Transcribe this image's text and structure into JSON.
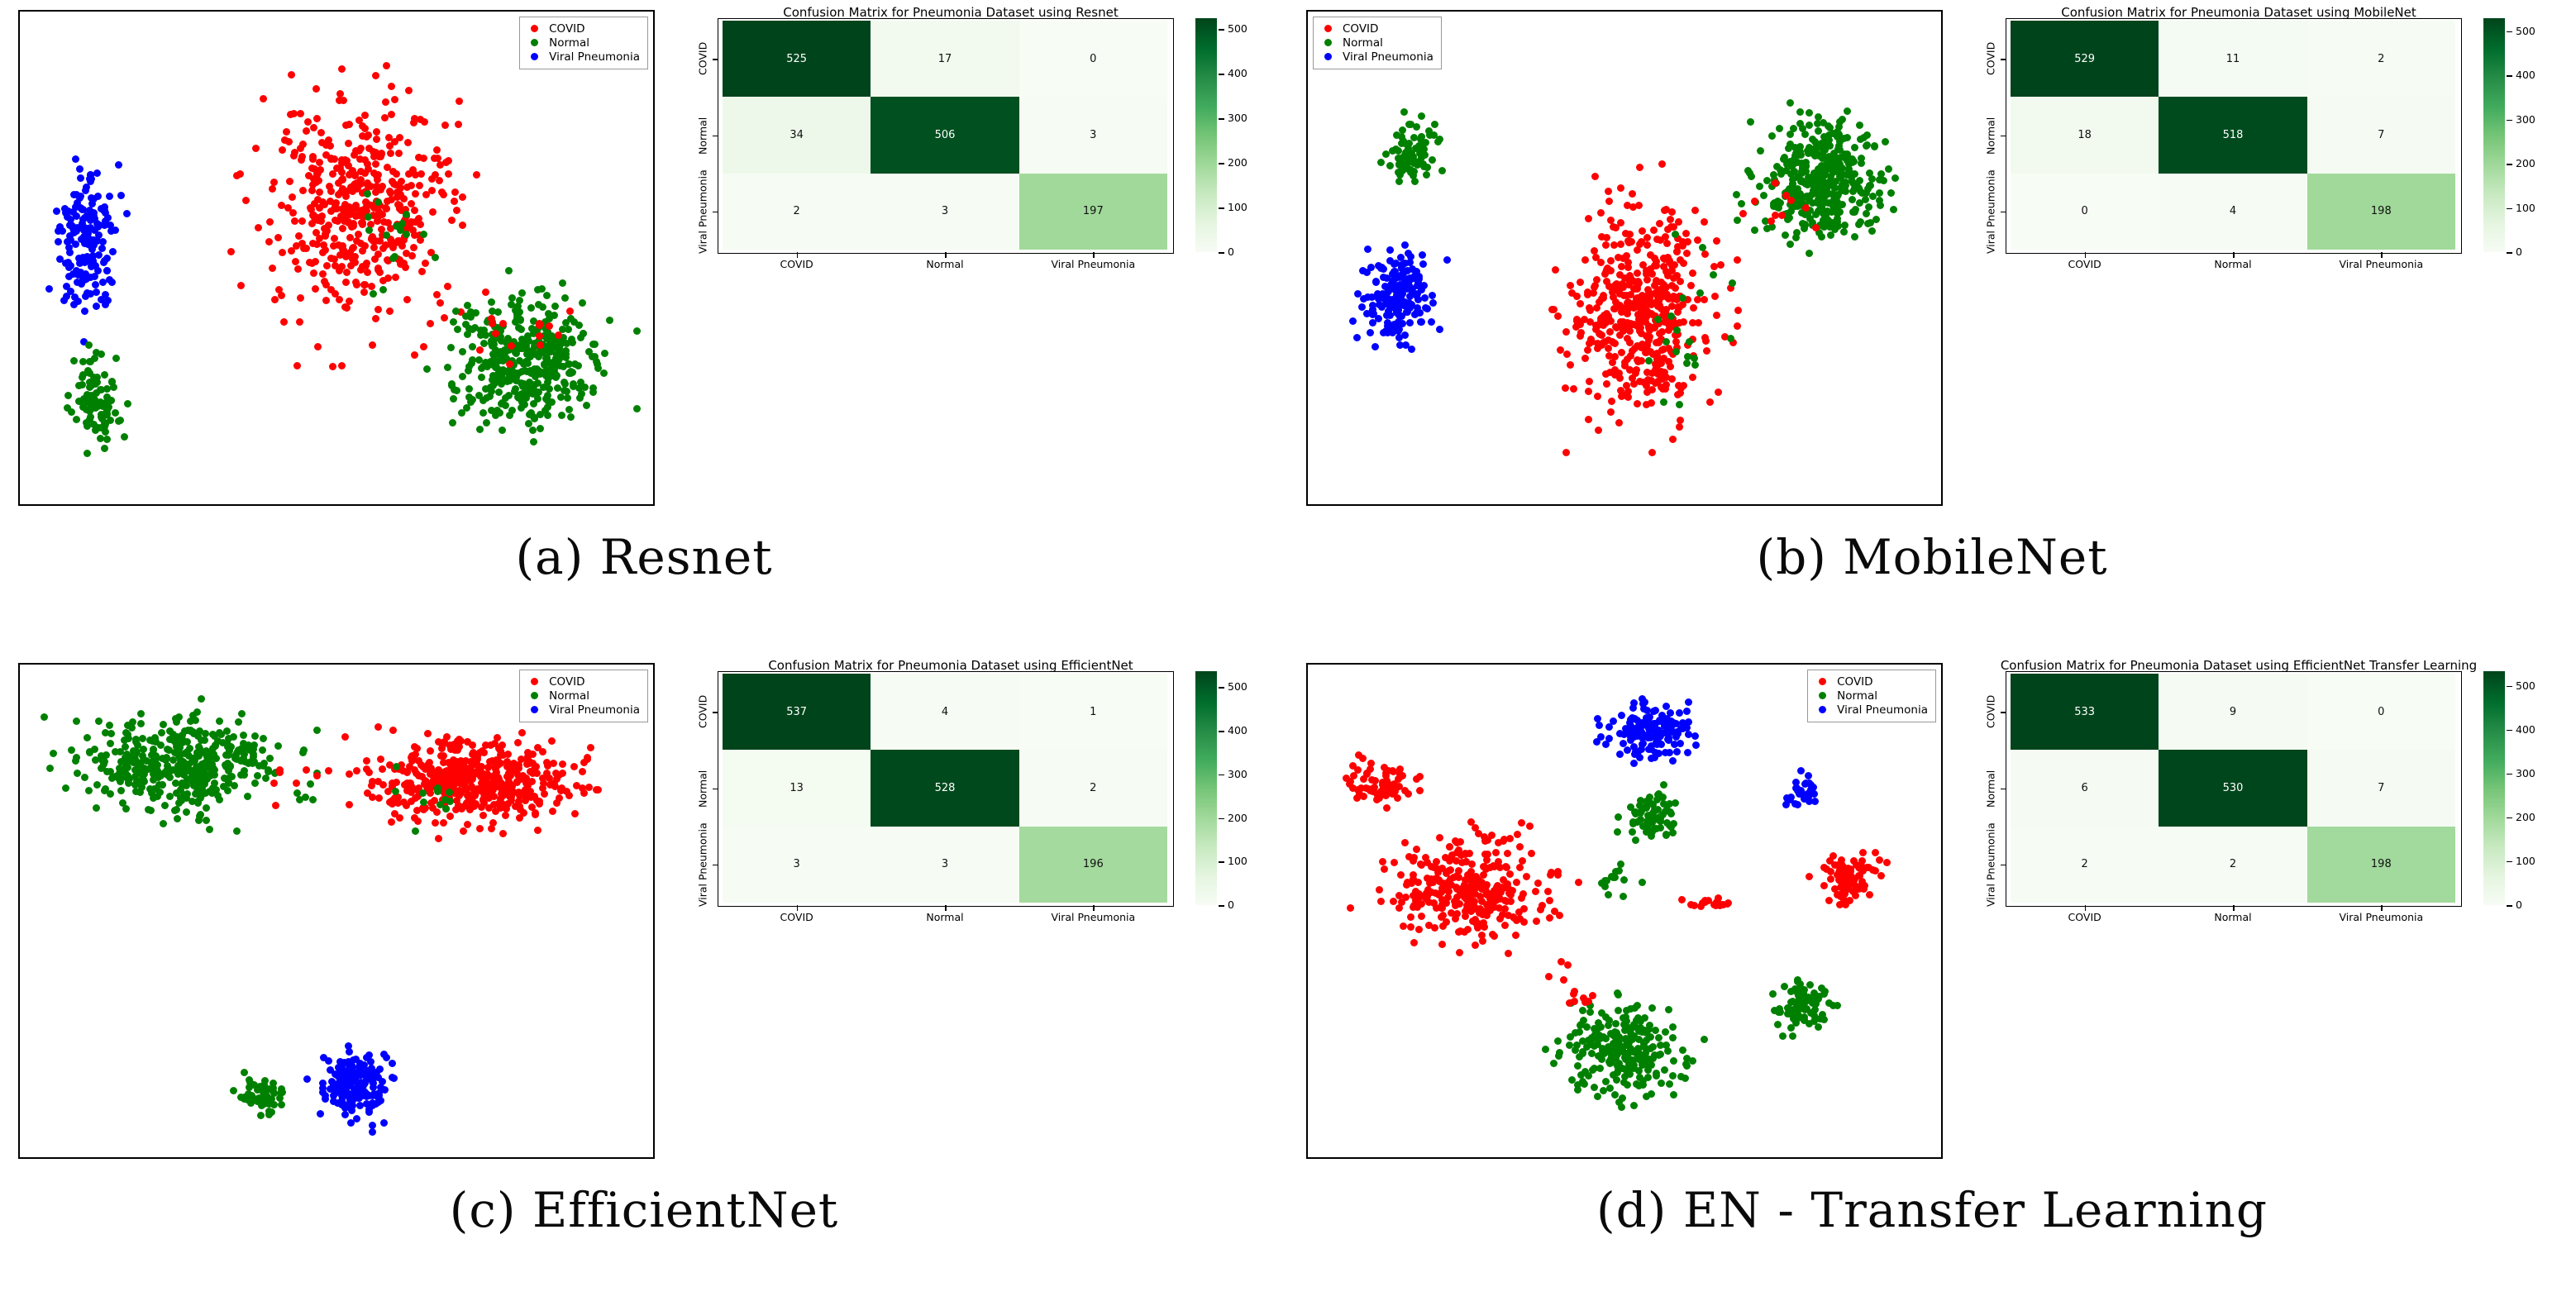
{
  "figure": {
    "classes": [
      "COVID",
      "Normal",
      "Viral Pneumonia"
    ],
    "class_colors": {
      "COVID": "#ff0000",
      "Normal": "#008000",
      "Viral Pneumonia": "#0000ff"
    },
    "colormap": "Greens",
    "colorbar_ticks": [
      "0",
      "100",
      "200",
      "300",
      "400",
      "500"
    ],
    "axis_labels": {
      "x": [
        "COVID",
        "Normal",
        "Viral Pneumonia"
      ],
      "y": [
        "COVID",
        "Normal",
        "Viral Pneumonia"
      ]
    }
  },
  "panels": [
    {
      "id": "a",
      "caption": "(a) Resnet",
      "legend_position": "top-right",
      "scatter": {
        "title": "",
        "type": "scatter"
      },
      "chart_data": {
        "type": "heatmap",
        "title": "Confusion Matrix for Pneumonia Dataset using Resnet",
        "xlabel": "",
        "ylabel": "",
        "x_tick_labels": [
          "COVID",
          "Normal",
          "Viral Pneumonia"
        ],
        "y_tick_labels": [
          "COVID",
          "Normal",
          "Viral Pneumonia"
        ],
        "values": [
          [
            525,
            17,
            0
          ],
          [
            34,
            506,
            3
          ],
          [
            2,
            3,
            197
          ]
        ],
        "colorbar_ticks": [
          0,
          100,
          200,
          300,
          400,
          500
        ],
        "vmin": 0,
        "vmax": 525
      }
    },
    {
      "id": "b",
      "caption": "(b) MobileNet",
      "legend_position": "top-left",
      "scatter": {
        "title": "",
        "type": "scatter"
      },
      "chart_data": {
        "type": "heatmap",
        "title": "Confusion Matrix for Pneumonia Dataset using MobileNet",
        "xlabel": "",
        "ylabel": "",
        "x_tick_labels": [
          "COVID",
          "Normal",
          "Viral Pneumonia"
        ],
        "y_tick_labels": [
          "COVID",
          "Normal",
          "Viral Pneumonia"
        ],
        "values": [
          [
            529,
            11,
            2
          ],
          [
            18,
            518,
            7
          ],
          [
            0,
            4,
            198
          ]
        ],
        "colorbar_ticks": [
          0,
          100,
          200,
          300,
          400,
          500
        ],
        "vmin": 0,
        "vmax": 529
      }
    },
    {
      "id": "c",
      "caption": "(c) EfficientNet",
      "legend_position": "top-right",
      "scatter": {
        "title": "",
        "type": "scatter"
      },
      "chart_data": {
        "type": "heatmap",
        "title": "Confusion Matrix for Pneumonia Dataset using EfficientNet",
        "xlabel": "",
        "ylabel": "",
        "x_tick_labels": [
          "COVID",
          "Normal",
          "Viral Pneumonia"
        ],
        "y_tick_labels": [
          "COVID",
          "Normal",
          "Viral Pneumonia"
        ],
        "values": [
          [
            537,
            4,
            1
          ],
          [
            13,
            528,
            2
          ],
          [
            3,
            3,
            196
          ]
        ],
        "colorbar_ticks": [
          0,
          100,
          200,
          300,
          400,
          500
        ],
        "vmin": 0,
        "vmax": 537
      }
    },
    {
      "id": "d",
      "caption": "(d) EN - Transfer Learning",
      "legend_position": "top-right",
      "scatter": {
        "title": "",
        "type": "scatter"
      },
      "chart_data": {
        "type": "heatmap",
        "title": "Confusion Matrix for Pneumonia Dataset using EfficientNet Transfer Learning",
        "xlabel": "",
        "ylabel": "",
        "x_tick_labels": [
          "COVID",
          "Normal",
          "Viral Pneumonia"
        ],
        "y_tick_labels": [
          "COVID",
          "Normal",
          "Viral Pneumonia"
        ],
        "values": [
          [
            533,
            9,
            0
          ],
          [
            6,
            530,
            7
          ],
          [
            2,
            2,
            198
          ]
        ],
        "colorbar_ticks": [
          0,
          100,
          200,
          300,
          400,
          500
        ],
        "vmin": 0,
        "vmax": 533
      }
    }
  ],
  "scatter_data": {
    "a": {
      "clusters": [
        {
          "class": "Viral Pneumonia",
          "cx": 0.105,
          "cy": 0.47,
          "rx": 0.055,
          "ry": 0.195,
          "n": 170
        },
        {
          "class": "Normal",
          "cx": 0.122,
          "cy": 0.8,
          "rx": 0.042,
          "ry": 0.105,
          "n": 95
        },
        {
          "class": "COVID",
          "cx": 0.535,
          "cy": 0.4,
          "rx": 0.155,
          "ry": 0.255,
          "n": 470
        },
        {
          "class": "Normal",
          "cx": 0.8,
          "cy": 0.715,
          "rx": 0.135,
          "ry": 0.155,
          "n": 400
        },
        {
          "class": "COVID",
          "cx": 0.78,
          "cy": 0.66,
          "rx": 0.1,
          "ry": 0.1,
          "n": 14
        },
        {
          "class": "Normal",
          "cx": 0.6,
          "cy": 0.45,
          "rx": 0.09,
          "ry": 0.13,
          "n": 16
        }
      ]
    },
    "b": {
      "clusters": [
        {
          "class": "Normal",
          "cx": 0.165,
          "cy": 0.29,
          "rx": 0.045,
          "ry": 0.075,
          "n": 80
        },
        {
          "class": "Viral Pneumonia",
          "cx": 0.14,
          "cy": 0.58,
          "rx": 0.065,
          "ry": 0.115,
          "n": 185
        },
        {
          "class": "COVID",
          "cx": 0.525,
          "cy": 0.605,
          "rx": 0.125,
          "ry": 0.245,
          "n": 480
        },
        {
          "class": "Normal",
          "cx": 0.805,
          "cy": 0.345,
          "rx": 0.115,
          "ry": 0.145,
          "n": 400
        },
        {
          "class": "COVID",
          "cx": 0.74,
          "cy": 0.4,
          "rx": 0.08,
          "ry": 0.09,
          "n": 10
        },
        {
          "class": "Normal",
          "cx": 0.6,
          "cy": 0.62,
          "rx": 0.09,
          "ry": 0.22,
          "n": 20
        }
      ]
    },
    "c": {
      "clusters": [
        {
          "class": "Normal",
          "cx": 0.255,
          "cy": 0.205,
          "rx": 0.185,
          "ry": 0.105,
          "n": 430
        },
        {
          "class": "COVID",
          "cx": 0.715,
          "cy": 0.235,
          "rx": 0.185,
          "ry": 0.095,
          "n": 470
        },
        {
          "class": "Viral Pneumonia",
          "cx": 0.53,
          "cy": 0.855,
          "rx": 0.065,
          "ry": 0.085,
          "n": 175
        },
        {
          "class": "Normal",
          "cx": 0.385,
          "cy": 0.875,
          "rx": 0.045,
          "ry": 0.045,
          "n": 55
        },
        {
          "class": "COVID",
          "cx": 0.43,
          "cy": 0.225,
          "rx": 0.06,
          "ry": 0.07,
          "n": 8
        },
        {
          "class": "Normal",
          "cx": 0.63,
          "cy": 0.255,
          "rx": 0.1,
          "ry": 0.09,
          "n": 12
        }
      ]
    },
    "d": {
      "clusters": [
        {
          "class": "COVID",
          "cx": 0.255,
          "cy": 0.455,
          "rx": 0.145,
          "ry": 0.125,
          "n": 300
        },
        {
          "class": "COVID",
          "cx": 0.115,
          "cy": 0.245,
          "rx": 0.055,
          "ry": 0.055,
          "n": 70
        },
        {
          "class": "Viral Pneumonia",
          "cx": 0.545,
          "cy": 0.135,
          "rx": 0.075,
          "ry": 0.065,
          "n": 140
        },
        {
          "class": "Viral Pneumonia",
          "cx": 0.785,
          "cy": 0.255,
          "rx": 0.035,
          "ry": 0.035,
          "n": 35
        },
        {
          "class": "Normal",
          "cx": 0.545,
          "cy": 0.305,
          "rx": 0.045,
          "ry": 0.055,
          "n": 70
        },
        {
          "class": "Normal",
          "cx": 0.495,
          "cy": 0.78,
          "rx": 0.105,
          "ry": 0.115,
          "n": 230
        },
        {
          "class": "Normal",
          "cx": 0.785,
          "cy": 0.695,
          "rx": 0.045,
          "ry": 0.055,
          "n": 85
        },
        {
          "class": "COVID",
          "cx": 0.855,
          "cy": 0.435,
          "rx": 0.055,
          "ry": 0.055,
          "n": 95
        },
        {
          "class": "COVID",
          "cx": 0.635,
          "cy": 0.485,
          "rx": 0.035,
          "ry": 0.012,
          "n": 22
        },
        {
          "class": "Normal",
          "cx": 0.48,
          "cy": 0.44,
          "rx": 0.04,
          "ry": 0.055,
          "n": 14
        },
        {
          "class": "COVID",
          "cx": 0.42,
          "cy": 0.66,
          "rx": 0.04,
          "ry": 0.06,
          "n": 12
        }
      ]
    }
  }
}
